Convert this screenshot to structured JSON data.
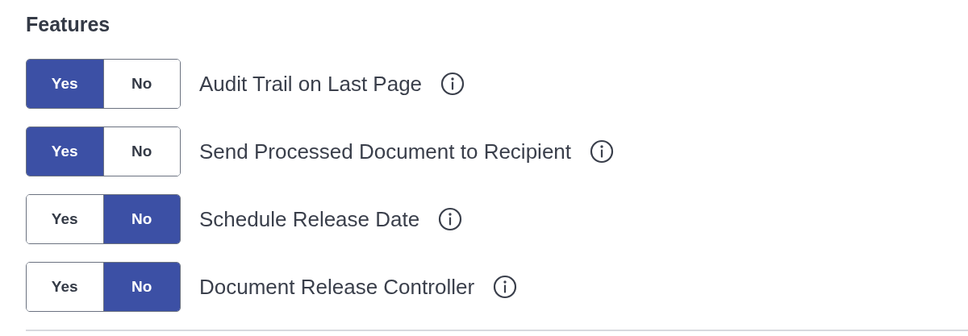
{
  "section": {
    "title": "Features"
  },
  "features": [
    {
      "label": "Audit Trail on Last Page",
      "options": [
        {
          "label": "Yes",
          "selected": true
        },
        {
          "label": "No",
          "selected": false
        }
      ]
    },
    {
      "label": "Send Processed Document to Recipient",
      "options": [
        {
          "label": "Yes",
          "selected": true
        },
        {
          "label": "No",
          "selected": false
        }
      ]
    },
    {
      "label": "Schedule Release Date",
      "options": [
        {
          "label": "Yes",
          "selected": false
        },
        {
          "label": "No",
          "selected": true
        }
      ]
    },
    {
      "label": "Document Release Controller",
      "options": [
        {
          "label": "Yes",
          "selected": false
        },
        {
          "label": "No",
          "selected": true
        }
      ]
    }
  ]
}
